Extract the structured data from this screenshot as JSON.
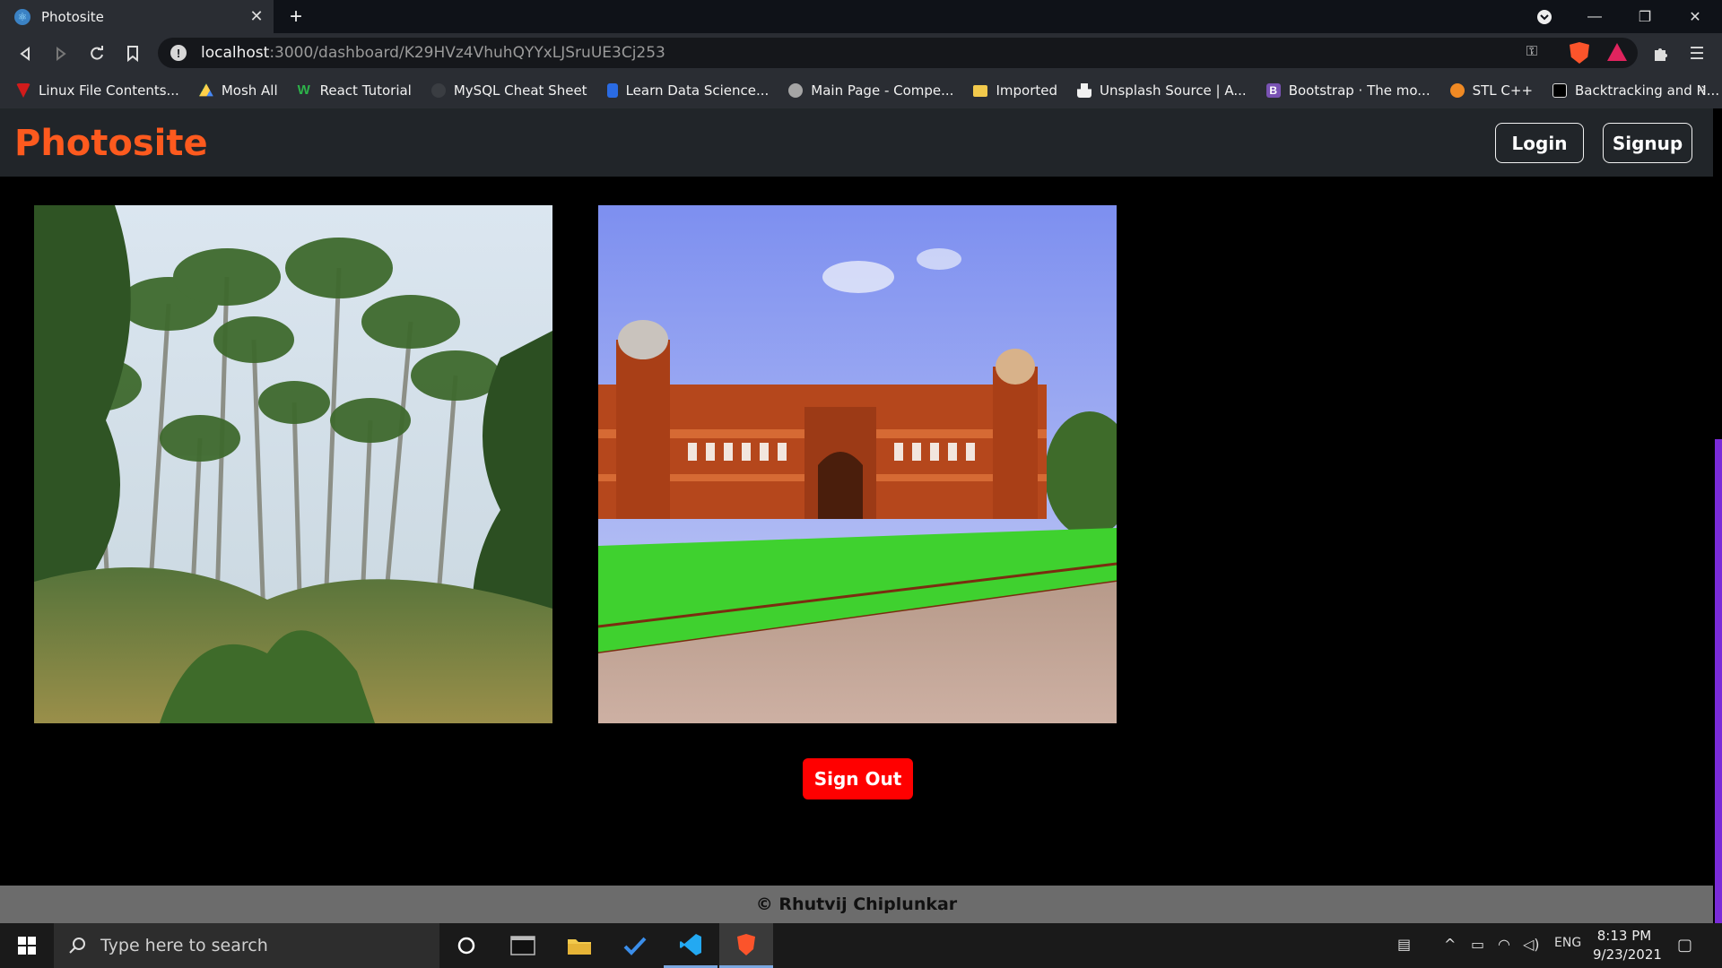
{
  "browser": {
    "tab_title": "Photosite",
    "url_host": "localhost",
    "url_path": ":3000/dashboard/K29HVz4VhuhQYYxLJSruUE3Cj253",
    "bookmarks": [
      "Linux File Contents...",
      "Mosh All",
      "React Tutorial",
      "MySQL Cheat Sheet",
      "Learn Data Science...",
      "Main Page - Compe...",
      "Imported",
      "Unsplash Source | A...",
      "Bootstrap · The mo...",
      "STL C++",
      "Backtracking and N..."
    ],
    "bookmarks_more": "»"
  },
  "page": {
    "brand": "Photosite",
    "login_label": "Login",
    "signup_label": "Signup",
    "signout_label": "Sign Out",
    "footer_text": "© Rhutvij Chiplunkar"
  },
  "taskbar": {
    "search_placeholder": "Type here to search",
    "language": "ENG",
    "time": "8:13 PM",
    "date": "9/23/2021"
  },
  "colors": {
    "brand": "#fd5a1e",
    "signout": "#ff0000",
    "navbar_bg": "#212529",
    "footer_bg": "#6c6c6c"
  }
}
